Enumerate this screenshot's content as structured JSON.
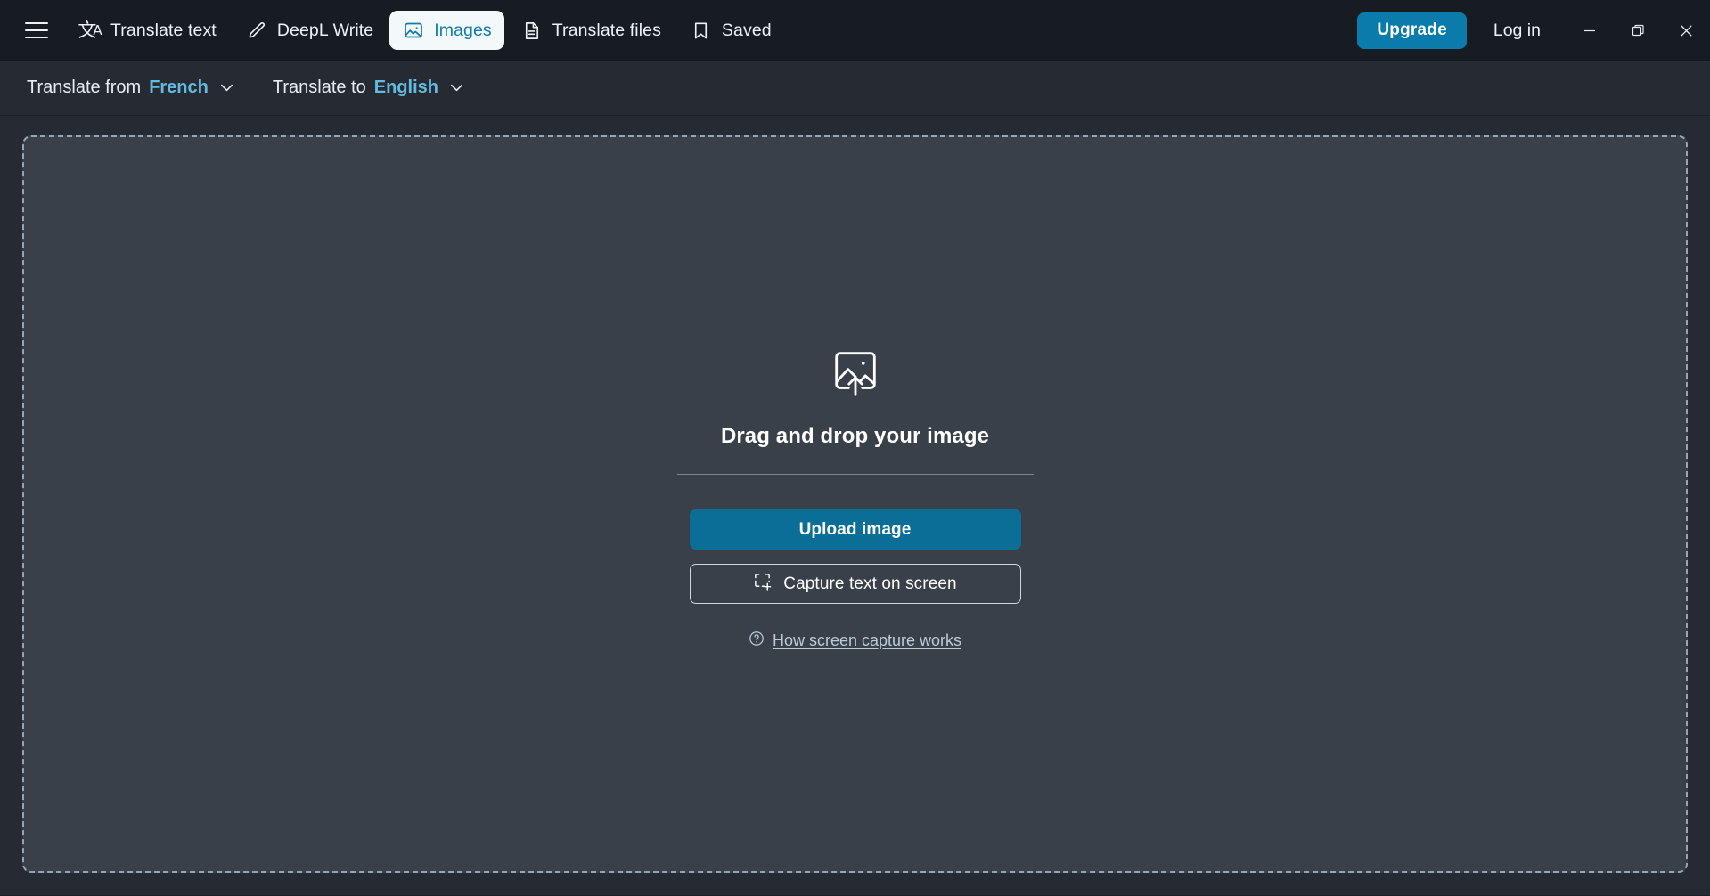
{
  "window": {
    "controls": {
      "minimize_label": "Minimize",
      "restore_label": "Restore",
      "close_label": "Close"
    }
  },
  "header": {
    "menu_label": "Menu",
    "tabs": [
      {
        "label": "Translate text",
        "icon": "translate-icon",
        "active": false
      },
      {
        "label": "DeepL Write",
        "icon": "pen-icon",
        "active": false
      },
      {
        "label": "Images",
        "icon": "image-icon",
        "active": true
      },
      {
        "label": "Translate files",
        "icon": "document-icon",
        "active": false
      },
      {
        "label": "Saved",
        "icon": "bookmark-icon",
        "active": false
      }
    ],
    "upgrade_label": "Upgrade",
    "login_label": "Log in"
  },
  "language_bar": {
    "source": {
      "label": "Translate from",
      "value": "French"
    },
    "target": {
      "label": "Translate to",
      "value": "English"
    }
  },
  "dropzone": {
    "icon": "image-upload-icon",
    "title": "Drag and drop your image",
    "upload_button": "Upload image",
    "capture_button": "Capture text on screen",
    "capture_icon": "screen-capture-icon",
    "help_icon": "question-circle-icon",
    "help_link": "How screen capture works"
  },
  "colors": {
    "titlebar_bg": "#171c23",
    "page_bg": "#262b33",
    "dropzone_bg": "#3a4049",
    "dropzone_border": "#99a4b2",
    "accent_blue": "#0a7bab",
    "upload_blue": "#0a6e97",
    "link_blue": "#63b9e0",
    "active_tab_bg": "#f3f8fb",
    "active_tab_fg": "#127cad"
  }
}
